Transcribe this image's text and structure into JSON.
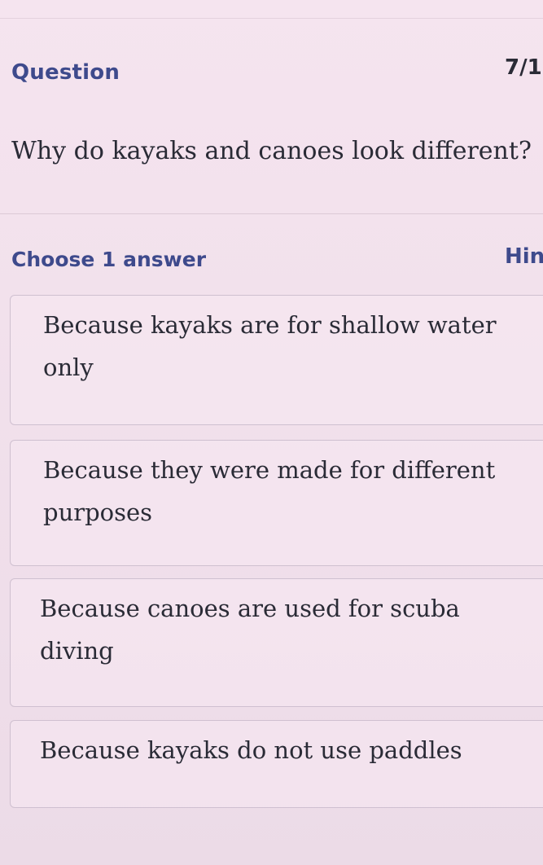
{
  "header": {
    "title": "Question",
    "progress": "7/1"
  },
  "question": {
    "text": "Why do kayaks and canoes look different?"
  },
  "answers": {
    "instruction": "Choose 1 answer",
    "hint_label": "Hin",
    "choices": [
      {
        "text": "Because kayaks are for shallow water only"
      },
      {
        "text": "Because they were made for different purposes"
      },
      {
        "text": "Because canoes are used for scuba diving"
      },
      {
        "text": "Because kayaks do not use paddles"
      }
    ]
  }
}
